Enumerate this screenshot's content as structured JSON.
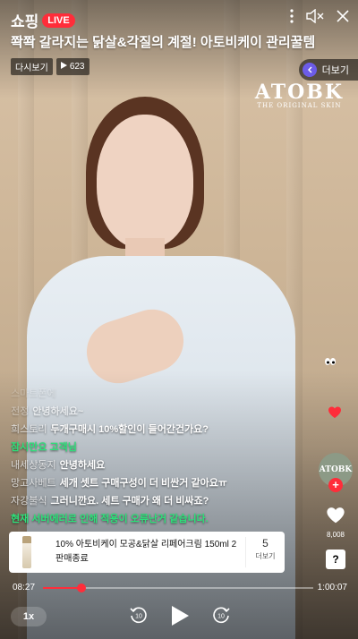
{
  "header": {
    "brand": "쇼핑",
    "live_badge": "LIVE",
    "title": "쫙쫙 갈라지는 닭살&각질의 계절! 아토비케이 관리꿀템",
    "replay_label": "다시보기",
    "view_count": "623",
    "more_label": "더보기",
    "icons": [
      "more-vertical-icon",
      "mute-icon",
      "close-icon"
    ]
  },
  "video": {
    "logo_main": "ATOBK",
    "logo_sub": "THE ORIGINAL SKIN"
  },
  "chat": [
    {
      "user": "스마트폰에",
      "message": "",
      "style": "fade1"
    },
    {
      "user": "전정",
      "message": "안녕하세요~",
      "style": "fade2"
    },
    {
      "user": "희스토리",
      "message": "두개구매시 10%할인이 들어간건가요?",
      "style": "normal"
    },
    {
      "user": "",
      "message": "잠시만요 고객님",
      "style": "green"
    },
    {
      "user": "내세상동지",
      "message": "안녕하세요",
      "style": "normal"
    },
    {
      "user": "망고사베트",
      "message": "세개 셋트 구매구성이 더 비싼거 같아요ㅠ",
      "style": "normal"
    },
    {
      "user": "자강불식",
      "message": "그러니깐요. 세트 구매가 왜 더 비싸죠?",
      "style": "normal"
    },
    {
      "user": "",
      "message": "현재 서버에러로 인해 적용이 오류난거 같습니다.",
      "style": "green"
    }
  ],
  "rail": {
    "avatar_text": "ATOBK",
    "like_count": "8,008",
    "help_label": "?"
  },
  "product": {
    "name": "10% 아토비케이 모공&닭살 리페어크림 150ml 2",
    "status": "판매종료",
    "count": "5",
    "more_label": "더보기"
  },
  "player": {
    "current_time": "08:27",
    "total_time": "1:00:07",
    "progress": 0.141,
    "speed": "1x"
  },
  "colors": {
    "accent": "#ff2d3a",
    "chat_highlight": "#2ee07a"
  }
}
